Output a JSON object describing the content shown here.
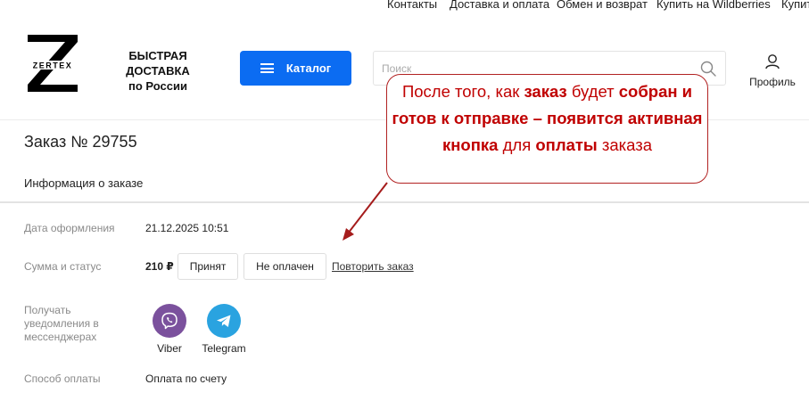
{
  "top_links": [
    "Контакты",
    "Доставка и оплата",
    "Обмен и возврат",
    "Купить на Wildberries",
    "Купит"
  ],
  "logo": {
    "letter": "Z",
    "brand": "ZERTEX"
  },
  "tagline": {
    "line1": "БЫСТРАЯ ДОСТАВКА",
    "line2": "по России"
  },
  "catalog_button": "Каталог",
  "search": {
    "placeholder": "Поиск"
  },
  "profile_label": "Профиль",
  "order": {
    "title": "Заказ № 29755",
    "info_tab": "Информация о заказе",
    "date_label": "Дата оформления",
    "date_value": "21.12.2025 10:51",
    "sum_label": "Сумма и статус",
    "price": "210 ₽",
    "status_accepted": "Принят",
    "status_unpaid": "Не оплачен",
    "repeat_link": "Повторить заказ",
    "notify_label": "Получать уведомления в мессенджерах",
    "messengers": [
      "Viber",
      "Telegram"
    ],
    "payment_label": "Способ оплаты",
    "payment_value": "Оплата по счету"
  },
  "callout": {
    "p1": "После  того, как ",
    "b1": "заказ",
    "p2": " будет ",
    "b2": "собран и готов к отправке – появится активная кнопка",
    "p3": " для ",
    "b3": "оплаты",
    "p4": " заказа"
  },
  "colors": {
    "accent": "#0b6cf2",
    "viber": "#7b519d",
    "telegram": "#2aa3e0",
    "callout": "#c00000"
  }
}
